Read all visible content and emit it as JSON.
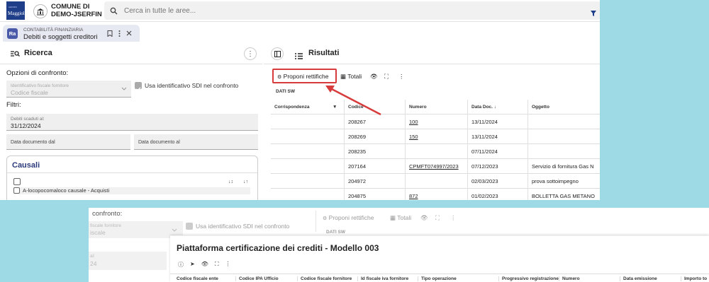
{
  "topbar": {
    "logo_text": "Maggioli",
    "logo_small": "GRUPPO",
    "town_line1": "COMUNE DI",
    "town_line2": "DEMO-JSERFIN",
    "search_placeholder": "Cerca in tutte le aree..."
  },
  "tab": {
    "app_icon": "Ra",
    "section": "CONTABILITÀ FINANZIARIA",
    "title": "Debiti e soggetti creditori"
  },
  "left": {
    "title": "Ricerca",
    "options_label": "Opzioni di confronto:",
    "select_label": "Identificativo fiscale fornitore",
    "select_value": "Codice fiscale",
    "sdi_label": "Usa identificativo SDI nel confronto",
    "filters_label": "Filtri:",
    "debiti_label": "Debiti scaduti al:",
    "debiti_value": "31/12/2024",
    "date_from": "Data documento dal",
    "date_to": "Data documento al",
    "causali_title": "Causali",
    "causali_item": "A-locopocomaloco causale - Acquisti"
  },
  "right": {
    "title": "Risultati",
    "proponi": "Proponi rettifiche",
    "totali": "Totali",
    "section": "DATI SW",
    "columns": [
      "Corrispondenza",
      "Codice",
      "Numero",
      "Data Doc.",
      "Oggetto"
    ],
    "rows": [
      {
        "codice": "208267",
        "numero": "100",
        "data": "13/11/2024",
        "oggetto": ""
      },
      {
        "codice": "208269",
        "numero": "150",
        "data": "13/11/2024",
        "oggetto": ""
      },
      {
        "codice": "208235",
        "numero": "",
        "data": "07/11/2024",
        "oggetto": ""
      },
      {
        "codice": "207164",
        "numero": "CPMFT074997/2023",
        "data": "07/12/2023",
        "oggetto": "Servizio di fornitura Gas N"
      },
      {
        "codice": "204972",
        "numero": "",
        "data": "02/03/2023",
        "oggetto": "prova sottoimpegno"
      },
      {
        "codice": "204875",
        "numero": "872",
        "data": "01/02/2023",
        "oggetto": "BOLLETTA GAS METANO"
      }
    ]
  },
  "second": {
    "confronto": "confronto:",
    "select_label": "fiscale fornitore",
    "select_value": "iscale",
    "sdi_label": "Usa identificativo SDI nel confronto",
    "debiti_frag1": "al:",
    "debiti_frag2": "24",
    "proponi": "Proponi rettifiche",
    "totali": "Totali",
    "section": "DATI SW",
    "modal_title": "Piattaforma certificazione dei crediti - Modello 003",
    "columns": [
      "Codice fiscale ente",
      "Codice IPA Ufficio",
      "Codice fiscale fornitore",
      "Id fiscale iva fornitore",
      "Tipo operazione",
      "Progressivo registrazione",
      "Numero",
      "Data emissione",
      "Importo to"
    ]
  },
  "colors": {
    "accent": "#2c3a7a",
    "highlight": "#d73b3b",
    "background": "#9ed9e6"
  }
}
